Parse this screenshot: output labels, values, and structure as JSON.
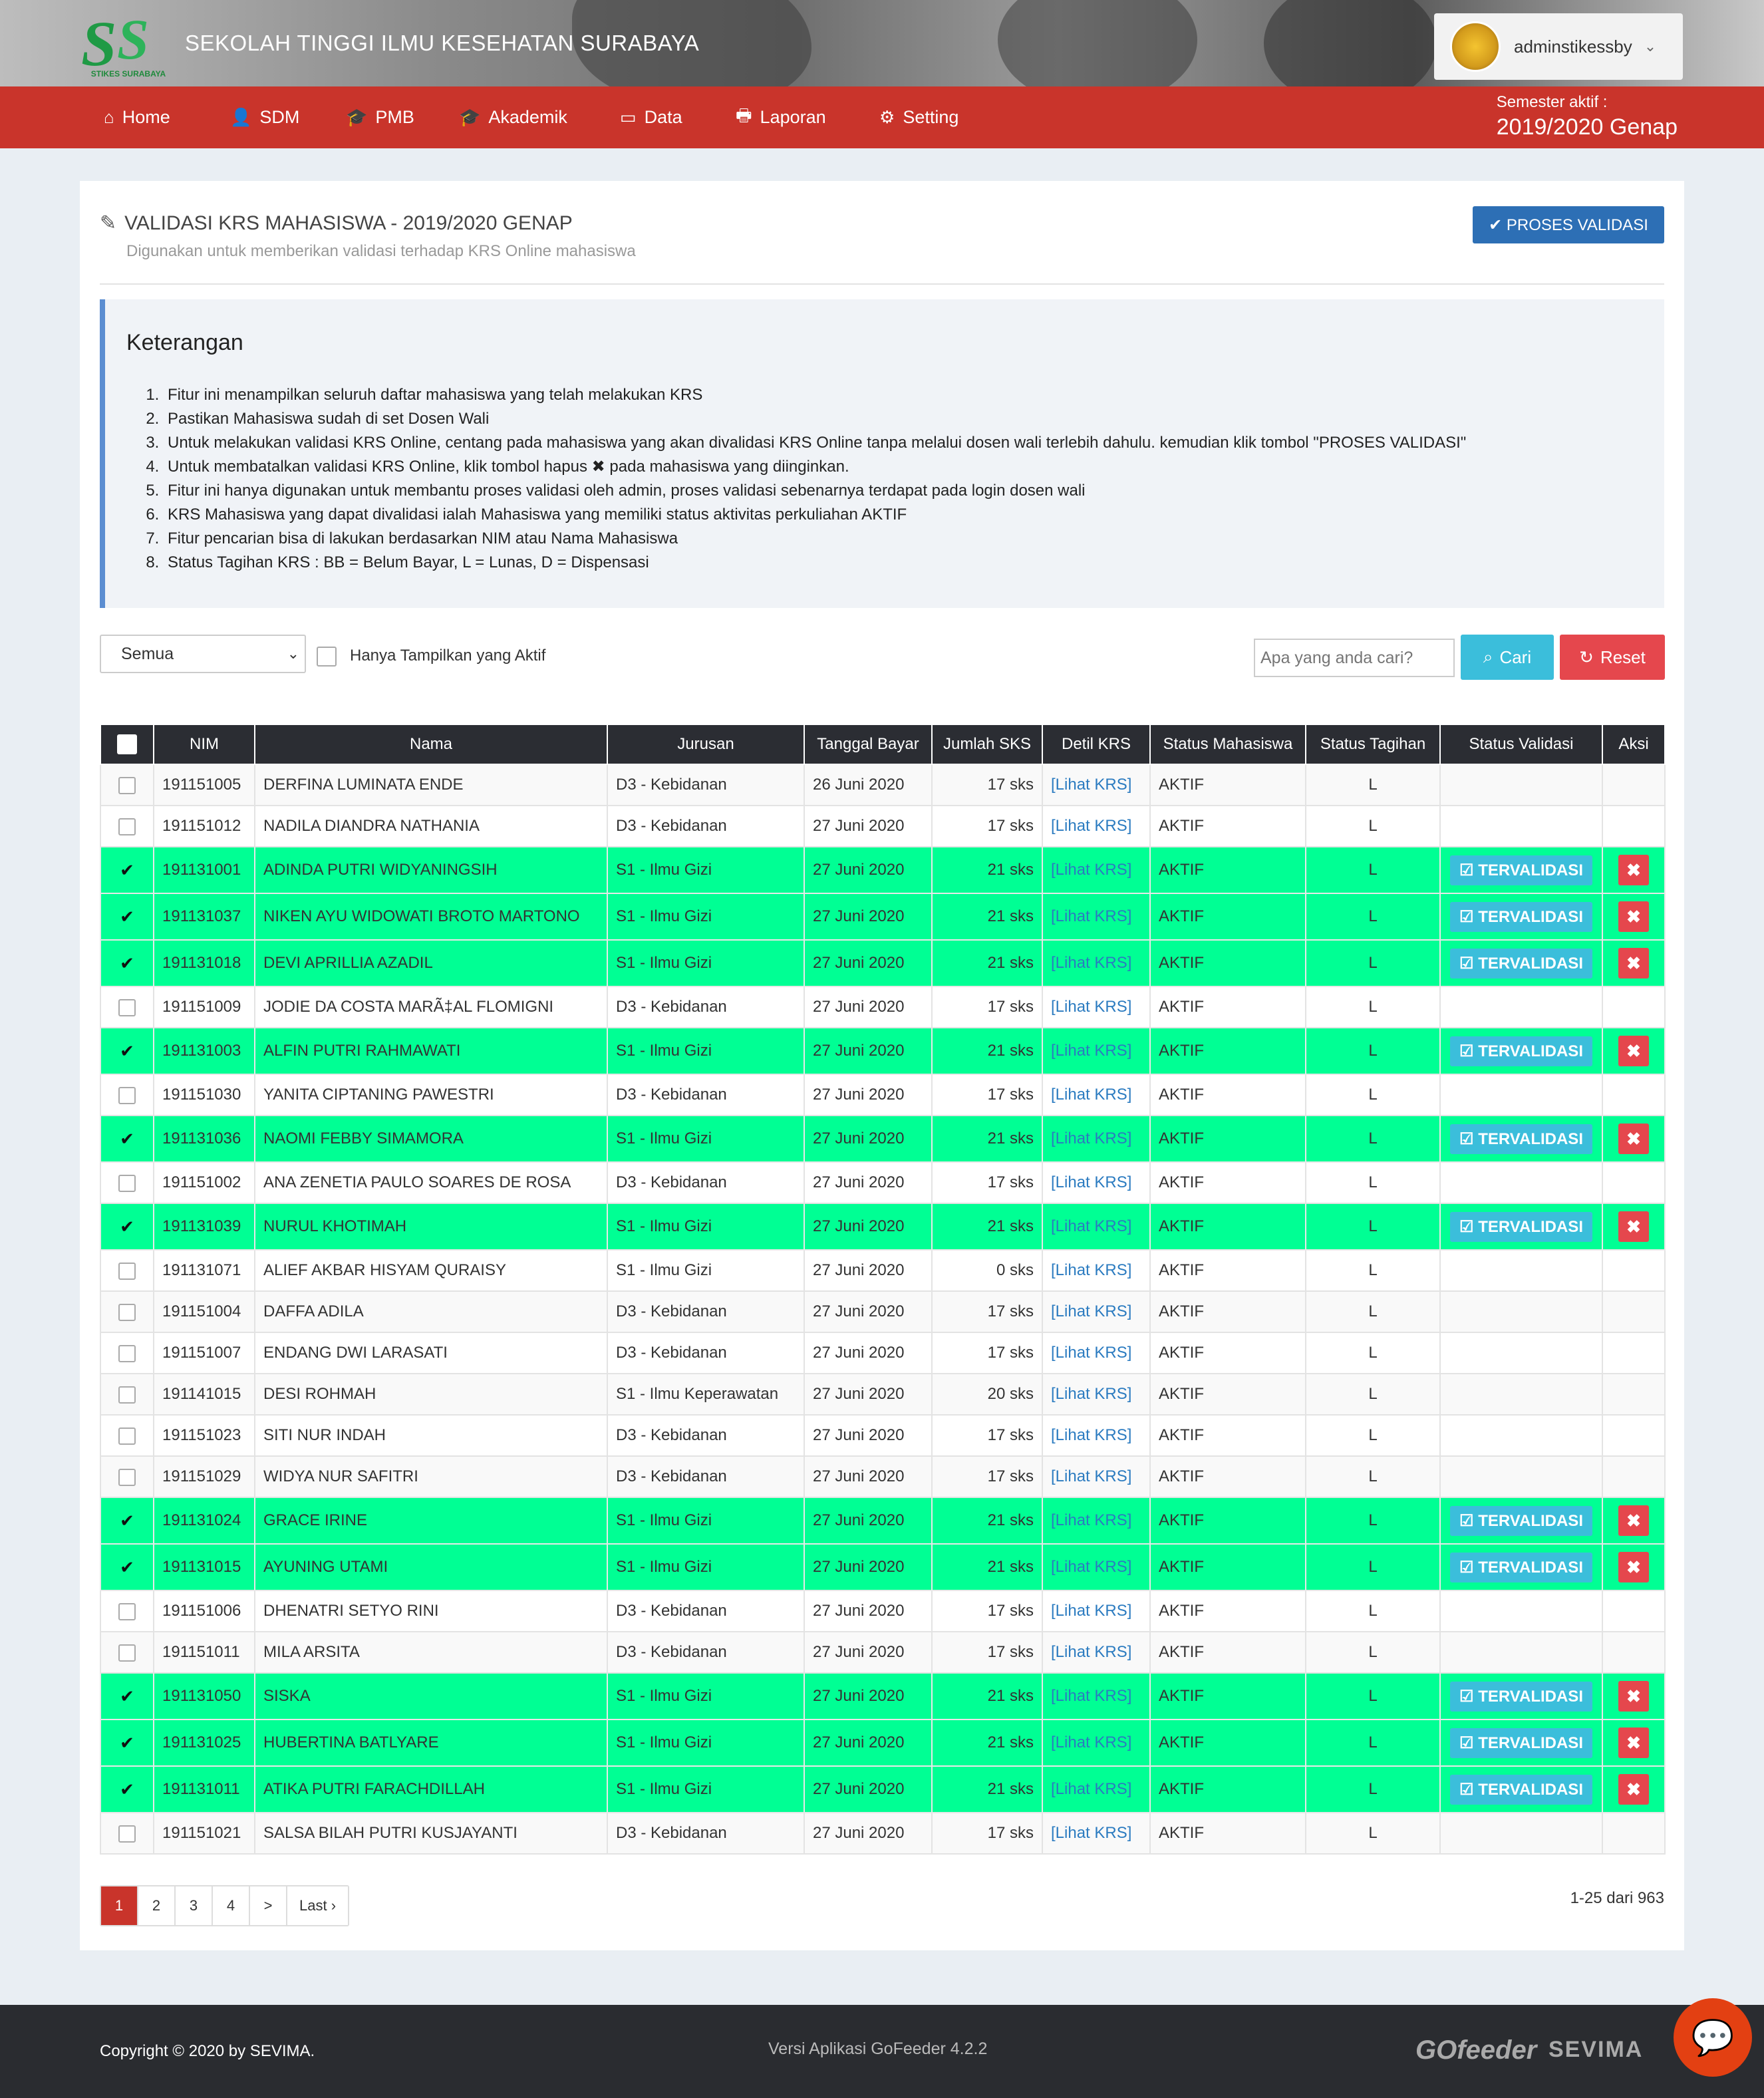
{
  "header": {
    "logo_text": "SS",
    "logo_sub": "STIKES SURABAYA",
    "site_title": "SEKOLAH TINGGI ILMU KESEHATAN SURABAYA",
    "username": "adminstikessby"
  },
  "nav": {
    "items": [
      {
        "icon": "home-icon",
        "glyph": "⌂",
        "label": "Home"
      },
      {
        "icon": "user-icon",
        "glyph": "👤",
        "label": "SDM"
      },
      {
        "icon": "graduation-cap-icon",
        "glyph": "🎓",
        "label": "PMB"
      },
      {
        "icon": "graduation-cap-icon",
        "glyph": "🎓",
        "label": "Akademik"
      },
      {
        "icon": "inbox-icon",
        "glyph": "▭",
        "label": "Data"
      },
      {
        "icon": "printer-icon",
        "glyph": "🖶",
        "label": "Laporan"
      },
      {
        "icon": "gear-icon",
        "glyph": "⚙",
        "label": "Setting"
      }
    ],
    "semester_label": "Semester aktif :",
    "semester_value": "2019/2020 Genap"
  },
  "page": {
    "title": "VALIDASI KRS MAHASISWA - 2019/2020 GENAP",
    "subtitle": "Digunakan untuk memberikan validasi terhadap KRS Online mahasiswa",
    "proses_button": "✔ PROSES VALIDASI"
  },
  "info": {
    "heading": "Keterangan",
    "items": [
      "Fitur ini menampilkan seluruh daftar mahasiswa yang telah melakukan KRS",
      "Pastikan Mahasiswa sudah di set Dosen Wali",
      "Untuk melakukan validasi KRS Online, centang pada mahasiswa yang akan divalidasi KRS Online tanpa melalui dosen wali terlebih dahulu. kemudian klik tombol \"PROSES VALIDASI\"",
      "Untuk membatalkan validasi KRS Online, klik tombol hapus ✖ pada mahasiswa yang diinginkan.",
      "Fitur ini hanya digunakan untuk membantu proses validasi oleh admin, proses validasi sebenarnya terdapat pada login dosen wali",
      "KRS Mahasiswa yang dapat divalidasi ialah Mahasiswa yang memiliki status aktivitas perkuliahan AKTIF",
      "Fitur pencarian bisa di lakukan berdasarkan NIM atau Nama Mahasiswa",
      "Status Tagihan KRS : BB = Belum Bayar, L = Lunas, D = Dispensasi"
    ]
  },
  "filter": {
    "select_value": "Semua",
    "checkbox_label": "Hanya Tampilkan yang Aktif",
    "search_placeholder": "Apa yang anda cari?",
    "cari_label": "Cari",
    "reset_label": "Reset"
  },
  "table": {
    "headers": [
      "NIM",
      "Nama",
      "Jurusan",
      "Tanggal Bayar",
      "Jumlah SKS",
      "Detil KRS",
      "Status Mahasiswa",
      "Status Tagihan",
      "Status Validasi",
      "Aksi"
    ],
    "link_label": "[Lihat KRS]",
    "validated_label": "TERVALIDASI",
    "delete_label": "✖",
    "rows": [
      {
        "nim": "191151005",
        "nama": "DERFINA LUMINATA ENDE",
        "jurusan": "D3 - Kebidanan",
        "tanggal": "26 Juni 2020",
        "sks": "17 sks",
        "status": "AKTIF",
        "tagihan": "L",
        "validated": false
      },
      {
        "nim": "191151012",
        "nama": "NADILA DIANDRA NATHANIA",
        "jurusan": "D3 - Kebidanan",
        "tanggal": "27 Juni 2020",
        "sks": "17 sks",
        "status": "AKTIF",
        "tagihan": "L",
        "validated": false
      },
      {
        "nim": "191131001",
        "nama": "ADINDA PUTRI WIDYANINGSIH",
        "jurusan": "S1 - Ilmu Gizi",
        "tanggal": "27 Juni 2020",
        "sks": "21 sks",
        "status": "AKTIF",
        "tagihan": "L",
        "validated": true
      },
      {
        "nim": "191131037",
        "nama": "NIKEN AYU WIDOWATI BROTO MARTONO",
        "jurusan": "S1 - Ilmu Gizi",
        "tanggal": "27 Juni 2020",
        "sks": "21 sks",
        "status": "AKTIF",
        "tagihan": "L",
        "validated": true
      },
      {
        "nim": "191131018",
        "nama": "DEVI APRILLIA AZADIL",
        "jurusan": "S1 - Ilmu Gizi",
        "tanggal": "27 Juni 2020",
        "sks": "21 sks",
        "status": "AKTIF",
        "tagihan": "L",
        "validated": true
      },
      {
        "nim": "191151009",
        "nama": "JODIE DA COSTA MARÃ‡AL FLOMIGNI",
        "jurusan": "D3 - Kebidanan",
        "tanggal": "27 Juni 2020",
        "sks": "17 sks",
        "status": "AKTIF",
        "tagihan": "L",
        "validated": false
      },
      {
        "nim": "191131003",
        "nama": "ALFIN PUTRI RAHMAWATI",
        "jurusan": "S1 - Ilmu Gizi",
        "tanggal": "27 Juni 2020",
        "sks": "21 sks",
        "status": "AKTIF",
        "tagihan": "L",
        "validated": true
      },
      {
        "nim": "191151030",
        "nama": "YANITA CIPTANING PAWESTRI",
        "jurusan": "D3 - Kebidanan",
        "tanggal": "27 Juni 2020",
        "sks": "17 sks",
        "status": "AKTIF",
        "tagihan": "L",
        "validated": false
      },
      {
        "nim": "191131036",
        "nama": "NAOMI FEBBY SIMAMORA",
        "jurusan": "S1 - Ilmu Gizi",
        "tanggal": "27 Juni 2020",
        "sks": "21 sks",
        "status": "AKTIF",
        "tagihan": "L",
        "validated": true
      },
      {
        "nim": "191151002",
        "nama": "ANA ZENETIA PAULO SOARES DE ROSA",
        "jurusan": "D3 - Kebidanan",
        "tanggal": "27 Juni 2020",
        "sks": "17 sks",
        "status": "AKTIF",
        "tagihan": "L",
        "validated": false
      },
      {
        "nim": "191131039",
        "nama": "NURUL KHOTIMAH",
        "jurusan": "S1 - Ilmu Gizi",
        "tanggal": "27 Juni 2020",
        "sks": "21 sks",
        "status": "AKTIF",
        "tagihan": "L",
        "validated": true
      },
      {
        "nim": "191131071",
        "nama": "ALIEF AKBAR HISYAM QURAISY",
        "jurusan": "S1 - Ilmu Gizi",
        "tanggal": "27 Juni 2020",
        "sks": "0 sks",
        "status": "AKTIF",
        "tagihan": "L",
        "validated": false
      },
      {
        "nim": "191151004",
        "nama": "DAFFA ADILA",
        "jurusan": "D3 - Kebidanan",
        "tanggal": "27 Juni 2020",
        "sks": "17 sks",
        "status": "AKTIF",
        "tagihan": "L",
        "validated": false
      },
      {
        "nim": "191151007",
        "nama": "ENDANG DWI LARASATI",
        "jurusan": "D3 - Kebidanan",
        "tanggal": "27 Juni 2020",
        "sks": "17 sks",
        "status": "AKTIF",
        "tagihan": "L",
        "validated": false
      },
      {
        "nim": "191141015",
        "nama": "DESI ROHMAH",
        "jurusan": "S1 - Ilmu Keperawatan",
        "tanggal": "27 Juni 2020",
        "sks": "20 sks",
        "status": "AKTIF",
        "tagihan": "L",
        "validated": false
      },
      {
        "nim": "191151023",
        "nama": "SITI NUR INDAH",
        "jurusan": "D3 - Kebidanan",
        "tanggal": "27 Juni 2020",
        "sks": "17 sks",
        "status": "AKTIF",
        "tagihan": "L",
        "validated": false
      },
      {
        "nim": "191151029",
        "nama": "WIDYA NUR SAFITRI",
        "jurusan": "D3 - Kebidanan",
        "tanggal": "27 Juni 2020",
        "sks": "17 sks",
        "status": "AKTIF",
        "tagihan": "L",
        "validated": false
      },
      {
        "nim": "191131024",
        "nama": "GRACE IRINE",
        "jurusan": "S1 - Ilmu Gizi",
        "tanggal": "27 Juni 2020",
        "sks": "21 sks",
        "status": "AKTIF",
        "tagihan": "L",
        "validated": true
      },
      {
        "nim": "191131015",
        "nama": "AYUNING UTAMI",
        "jurusan": "S1 - Ilmu Gizi",
        "tanggal": "27 Juni 2020",
        "sks": "21 sks",
        "status": "AKTIF",
        "tagihan": "L",
        "validated": true
      },
      {
        "nim": "191151006",
        "nama": "DHENATRI SETYO RINI",
        "jurusan": "D3 - Kebidanan",
        "tanggal": "27 Juni 2020",
        "sks": "17 sks",
        "status": "AKTIF",
        "tagihan": "L",
        "validated": false
      },
      {
        "nim": "191151011",
        "nama": "MILA ARSITA",
        "jurusan": "D3 - Kebidanan",
        "tanggal": "27 Juni 2020",
        "sks": "17 sks",
        "status": "AKTIF",
        "tagihan": "L",
        "validated": false
      },
      {
        "nim": "191131050",
        "nama": "SISKA",
        "jurusan": "S1 - Ilmu Gizi",
        "tanggal": "27 Juni 2020",
        "sks": "21 sks",
        "status": "AKTIF",
        "tagihan": "L",
        "validated": true
      },
      {
        "nim": "191131025",
        "nama": "HUBERTINA BATLYARE",
        "jurusan": "S1 - Ilmu Gizi",
        "tanggal": "27 Juni 2020",
        "sks": "21 sks",
        "status": "AKTIF",
        "tagihan": "L",
        "validated": true
      },
      {
        "nim": "191131011",
        "nama": "ATIKA PUTRI FARACHDILLAH",
        "jurusan": "S1 - Ilmu Gizi",
        "tanggal": "27 Juni 2020",
        "sks": "21 sks",
        "status": "AKTIF",
        "tagihan": "L",
        "validated": true
      },
      {
        "nim": "191151021",
        "nama": "SALSA BILAH PUTRI KUSJAYANTI",
        "jurusan": "D3 - Kebidanan",
        "tanggal": "27 Juni 2020",
        "sks": "17 sks",
        "status": "AKTIF",
        "tagihan": "L",
        "validated": false
      }
    ]
  },
  "pagination": {
    "pages": [
      "1",
      "2",
      "3",
      "4",
      ">",
      "Last ›"
    ],
    "active_page": "1",
    "info": "1-25 dari 963"
  },
  "footer": {
    "copyright": "Copyright © 2020 by SEVIMA.",
    "version": "Versi Aplikasi GoFeeder 4.2.2",
    "gofeeder_logo": "GOfeeder",
    "sevima_logo": "SEVIMA"
  },
  "colors": {
    "brand_red": "#c9342b",
    "validated_green": "#00ff94",
    "info_blue": "#3bbedb",
    "primary_blue": "#2d6fb5",
    "danger_red": "#e5474d"
  }
}
